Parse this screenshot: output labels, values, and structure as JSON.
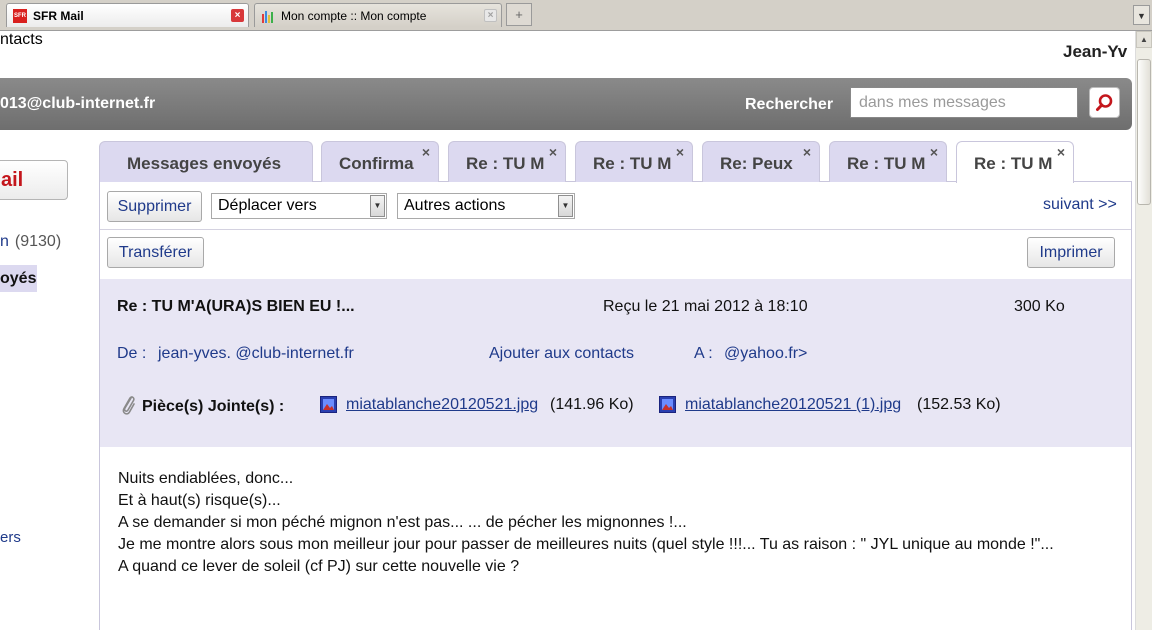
{
  "browser": {
    "tabs": [
      {
        "label": "SFR Mail",
        "active": true
      },
      {
        "label": "Mon compte :: Mon compte",
        "active": false
      }
    ],
    "new_tab": "+",
    "tab_list": "▼",
    "sfr_favicon_text": "SFR"
  },
  "page": {
    "contacts_link": "ntacts",
    "user_name": "Jean-Yv",
    "account_email": "013@club-internet.fr",
    "search": {
      "label": "Rechercher",
      "placeholder": "dans mes messages"
    }
  },
  "sidebar": {
    "new_mail_label": "ail",
    "inbox_label": "n",
    "inbox_count": "(9130)",
    "sent_label": "oyés",
    "other_label": "ers"
  },
  "mail_tabs": [
    {
      "label": "Messages envoyés",
      "closable": false,
      "active": false
    },
    {
      "label": "Confirma",
      "closable": true,
      "active": false
    },
    {
      "label": "Re : TU M",
      "closable": true,
      "active": false
    },
    {
      "label": "Re : TU M",
      "closable": true,
      "active": false
    },
    {
      "label": "Re: Peux",
      "closable": true,
      "active": false
    },
    {
      "label": "Re : TU M",
      "closable": true,
      "active": false
    },
    {
      "label": "Re : TU M",
      "closable": true,
      "active": true
    }
  ],
  "close_glyph": "×",
  "toolbar": {
    "delete": "Supprimer",
    "move_to": "Déplacer vers",
    "other_actions": "Autres actions",
    "next": "suivant >>",
    "forward": "Transférer",
    "print": "Imprimer",
    "dropdown_arrow": "▼"
  },
  "message": {
    "subject": "Re : TU M'A(URA)S BIEN EU !...",
    "received": "Reçu le 21 mai 2012 à 18:10",
    "size": "300 Ko",
    "from_label": "De :",
    "from_value": "jean-yves.                    @club-internet.fr",
    "add_contact": "Ajouter aux contacts",
    "to_label": "A :",
    "to_value": "                                     @yahoo.fr>",
    "attachments_label": "Pièce(s) Jointe(s) :",
    "attachments": [
      {
        "name": "miatablanche20120521.jpg",
        "size": "(141.96 Ko)"
      },
      {
        "name": "miatablanche20120521 (1).jpg",
        "size": "(152.53 Ko)"
      }
    ],
    "body_lines": [
      "Nuits endiablées, donc...",
      "Et à haut(s) risque(s)...",
      "A se demander si mon péché mignon n'est pas... ... de pécher les mignonnes !...",
      "Je me montre alors sous mon meilleur jour pour passer de meilleures nuits (quel style !!!... Tu as raison : \" JYL unique au monde !\"...",
      "A quand ce lever de soleil (cf PJ) sur cette nouvelle vie ?"
    ]
  },
  "colors": {
    "link_blue": "#1f3a8a",
    "tab_lavender": "#dcd9f0",
    "header_gray": "#7c7c7c",
    "sfr_red": "#c4161c"
  }
}
